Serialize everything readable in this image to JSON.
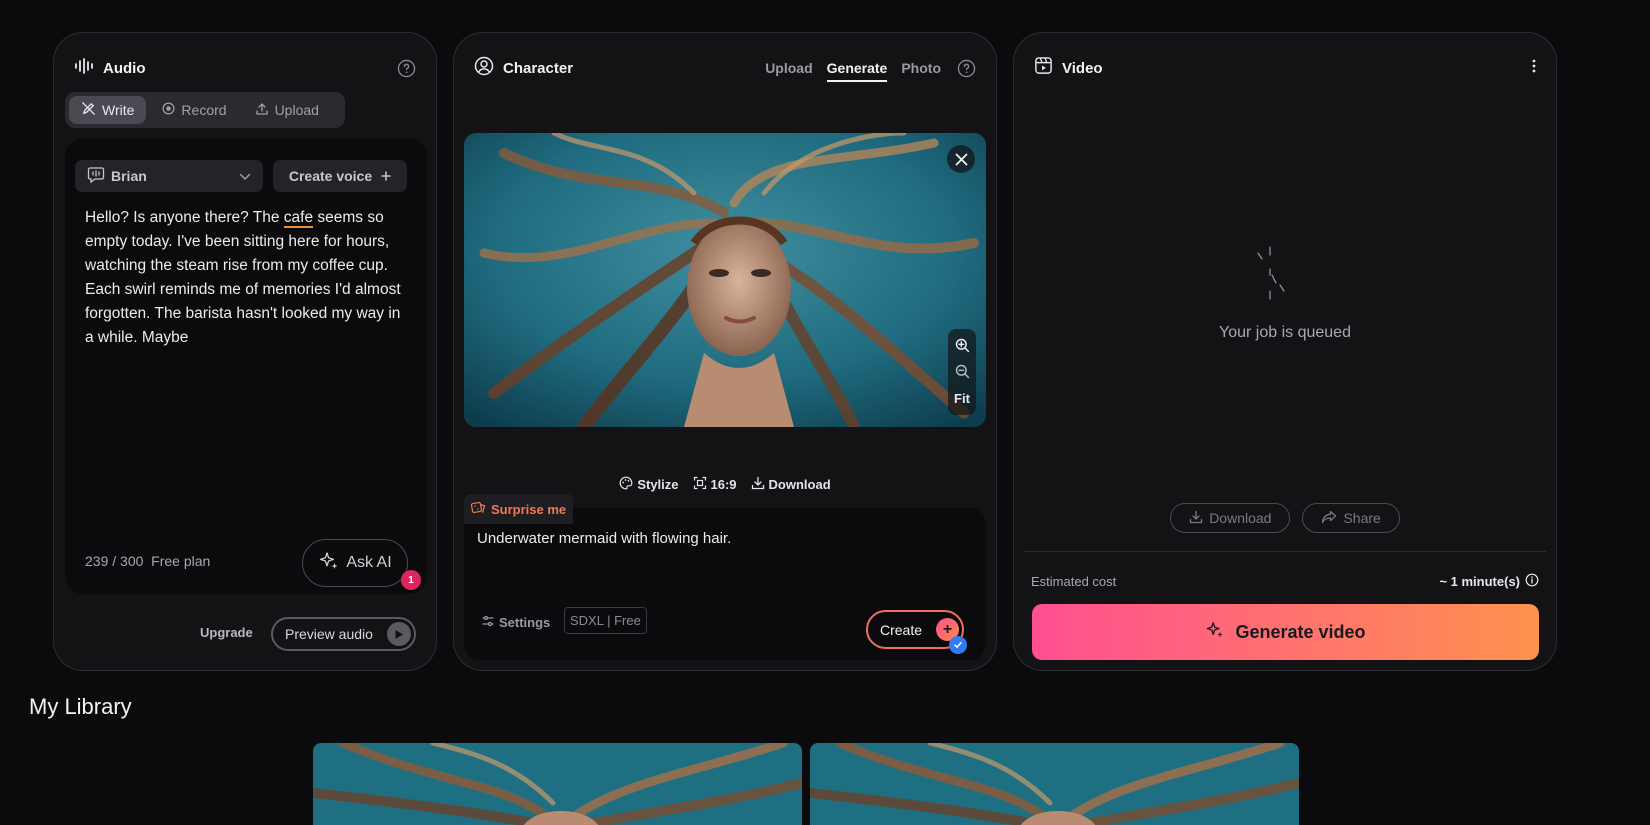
{
  "audio": {
    "title": "Audio",
    "tabs": [
      {
        "label": "Write",
        "icon": "pen-off-icon",
        "active": true
      },
      {
        "label": "Record",
        "icon": "record-icon",
        "active": false
      },
      {
        "label": "Upload",
        "icon": "upload-icon",
        "active": false
      }
    ],
    "voice": "Brian",
    "create_voice_label": "Create voice",
    "script": {
      "before": "Hello? Is anyone there? The ",
      "underlined": "cafe",
      "after": " seems so empty today. I've been sitting here for hours, watching the steam rise from my coffee cup. Each swirl reminds me of memories I'd almost forgotten. The barista hasn't looked my way in a while. Maybe"
    },
    "char_count": "239 / 300",
    "plan": "Free plan",
    "ask_ai_label": "Ask AI",
    "notification_count": "1",
    "upgrade_label": "Upgrade",
    "preview_label": "Preview audio"
  },
  "character": {
    "title": "Character",
    "tabs": [
      {
        "label": "Upload",
        "active": false
      },
      {
        "label": "Generate",
        "active": true
      },
      {
        "label": "Photo",
        "active": false
      }
    ],
    "fit_label": "Fit",
    "tools": [
      {
        "label": "Stylize",
        "icon": "palette-icon"
      },
      {
        "label": "16:9",
        "icon": "aspect-ratio-icon"
      },
      {
        "label": "Download",
        "icon": "download-icon"
      }
    ],
    "surprise_label": "Surprise me",
    "prompt": "Underwater mermaid with flowing hair.",
    "settings_label": "Settings",
    "model": "SDXL | Free",
    "create_label": "Create"
  },
  "video": {
    "title": "Video",
    "status": "Your job is queued",
    "download_label": "Download",
    "share_label": "Share",
    "cost_label": "Estimated cost",
    "cost_value": "~ 1 minute(s)",
    "generate_label": "Generate video"
  },
  "library": {
    "title": "My Library"
  },
  "colors": {
    "accent_start": "#ff4f91",
    "accent_end": "#ff924e",
    "surprise": "#f07855",
    "badge": "#e0245e",
    "check": "#2f7cf6"
  }
}
